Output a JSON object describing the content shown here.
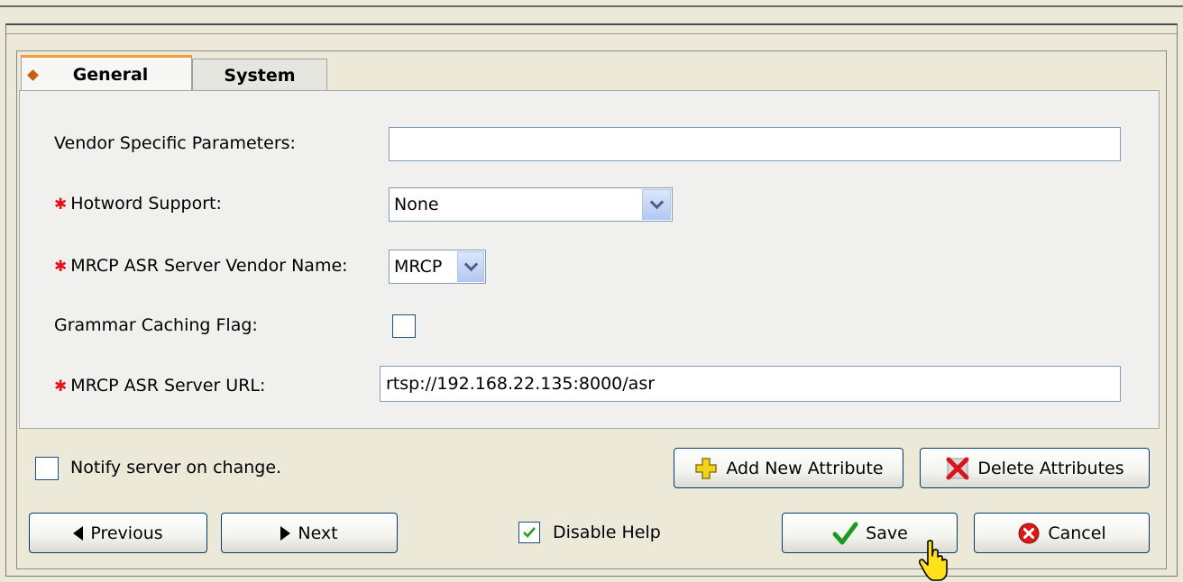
{
  "tabs": [
    {
      "label": "General",
      "active": true
    },
    {
      "label": "System",
      "active": false
    }
  ],
  "form": {
    "vendor_params": {
      "label": "Vendor Specific Parameters:",
      "value": ""
    },
    "hotword": {
      "label": "Hotword Support:",
      "required_mark": "✱",
      "value": "None"
    },
    "vendor_name": {
      "label": "MRCP ASR Server Vendor Name:",
      "required_mark": "✱",
      "value": "MRCP"
    },
    "grammar_caching": {
      "label": "Grammar Caching Flag:",
      "checked": false
    },
    "server_url": {
      "label": "MRCP ASR Server URL:",
      "required_mark": "✱",
      "value": "rtsp://192.168.22.135:8000/asr"
    }
  },
  "notify": {
    "label": "Notify server on change.",
    "checked": false
  },
  "buttons": {
    "add_attribute": "Add New Attribute",
    "delete_attributes": "Delete Attributes",
    "previous": "Previous",
    "next": "Next",
    "save": "Save",
    "cancel": "Cancel"
  },
  "disable_help": {
    "label": "Disable Help",
    "checked": true
  },
  "colors": {
    "required": "#e8101a",
    "tab_accent": "#f0a030",
    "check_green": "#1e9a1e",
    "cancel_red": "#d81a1a",
    "add_yellow": "#f2d21a",
    "delete_red": "#d8141a"
  }
}
